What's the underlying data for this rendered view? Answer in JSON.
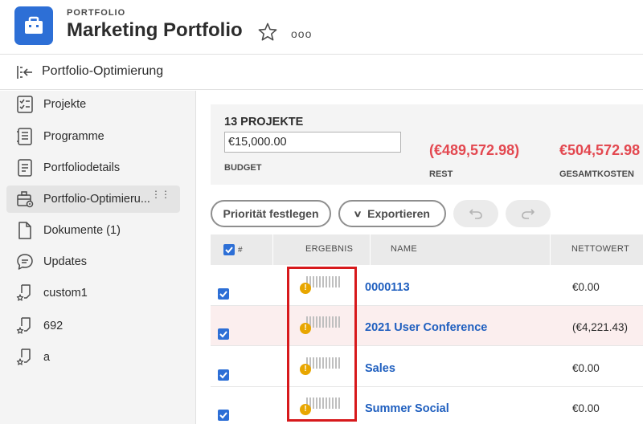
{
  "header": {
    "kicker": "PORTFOLIO",
    "title": "Marketing Portfolio",
    "app_icon": "briefcase-icon",
    "star_icon": "star-icon",
    "more_label": "ooo"
  },
  "subheader": {
    "title": "Portfolio-Optimierung",
    "icon": "collapse-sidebar-icon"
  },
  "sidebar": {
    "items": [
      {
        "label": "Projekte",
        "icon": "projects-icon",
        "active": false
      },
      {
        "label": "Programme",
        "icon": "programs-icon",
        "active": false
      },
      {
        "label": "Portfoliodetails",
        "icon": "details-icon",
        "active": false
      },
      {
        "label": "Portfolio-Optimieru...",
        "icon": "portfolio-optimizer-icon",
        "active": true
      },
      {
        "label": "Dokumente (1)",
        "icon": "document-icon",
        "active": false
      },
      {
        "label": "Updates",
        "icon": "updates-icon",
        "active": false
      },
      {
        "label": "custom1",
        "icon": "custom-page-icon",
        "active": false
      },
      {
        "label": "692",
        "icon": "custom-page-icon",
        "active": false
      },
      {
        "label": "a",
        "icon": "custom-page-icon",
        "active": false
      }
    ]
  },
  "summary": {
    "count_label": "13 PROJEKTE",
    "budget_value": "€15,000.00",
    "budget_label": "BUDGET",
    "rest_value": "(€489,572.98)",
    "rest_label": "REST",
    "total_value": "€504,572.98",
    "total_label": "GESAMTKOSTEN"
  },
  "toolbar": {
    "priority_label": "Priorität festlegen",
    "export_label": "Exportieren",
    "undo_icon": "undo-icon",
    "redo_icon": "redo-icon"
  },
  "table": {
    "headers": {
      "number": "#",
      "result": "ERGEBNIS",
      "name": "NAME",
      "net_value": "NETTOWERT"
    },
    "rows": [
      {
        "checked": true,
        "name": "0000113",
        "net_value": "€0.00",
        "highlight": false
      },
      {
        "checked": true,
        "name": "2021 User Conference",
        "net_value": "(€4,221.43)",
        "highlight": true
      },
      {
        "checked": true,
        "name": "Sales",
        "net_value": "€0.00",
        "highlight": false
      },
      {
        "checked": true,
        "name": "Summer Social",
        "net_value": "€0.00",
        "highlight": false
      }
    ]
  },
  "colors": {
    "accent": "#2d6fd6",
    "negative": "#e34850",
    "warning": "#e8a600",
    "callout": "#d7191c"
  }
}
